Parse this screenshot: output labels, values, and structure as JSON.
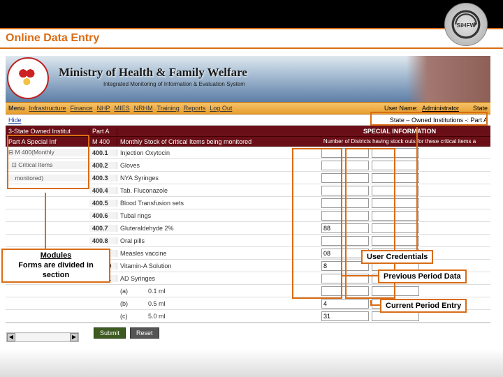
{
  "slide": {
    "title": "Online Data Entry"
  },
  "logo": {
    "name": "sihfw-logo"
  },
  "banner": {
    "ministry": "Ministry of Health & Family Welfare",
    "subtitle": "Integrated Monitoring of Information & Evaluation System",
    "badge_alt": "NRHM"
  },
  "menubar": {
    "menu_label": "Menu",
    "items": [
      "Infrastructure",
      "Finance",
      "NHP",
      "MIES",
      "NRHM",
      "Training",
      "Reports",
      "Log Out"
    ],
    "user_label": "User Name:",
    "user_value": "Administrator",
    "state_label": "State"
  },
  "substrip": {
    "hide": "Hide",
    "right": "State – Owned Institutions -: Part A"
  },
  "special_row": {
    "left": "3-State Owned Institut",
    "code": "Part A",
    "desc": "",
    "info_label": "SPECIAL INFORMATION",
    "info_sub": "Number of Districts having stock outs for these critical items a"
  },
  "header_row": {
    "left": "Part A Special Inf",
    "code": "M 400",
    "desc": "Monthly Stock of Critical Items being monitored"
  },
  "tree": {
    "root": "M 400(Monthly",
    "child": "Critical Items",
    "child2": "monitored)"
  },
  "rows": [
    {
      "code": "400.1",
      "desc": "Injection Oxytocin",
      "prev": "",
      "curr": ""
    },
    {
      "code": "400.2",
      "desc": "Gloves",
      "prev": "",
      "curr": ""
    },
    {
      "code": "400.3",
      "desc": "NYA Syringes",
      "prev": "",
      "curr": ""
    },
    {
      "code": "400.4",
      "desc": "Tab. Fluconazole",
      "prev": "",
      "curr": ""
    },
    {
      "code": "400.5",
      "desc": "Blood Transfusion sets",
      "prev": "",
      "curr": ""
    },
    {
      "code": "400.6",
      "desc": "Tubal rings",
      "prev": "",
      "curr": ""
    },
    {
      "code": "400.7",
      "desc": "Gluteraldehyde 2%",
      "prev": "88",
      "curr": ""
    },
    {
      "code": "400.8",
      "desc": "Oral pills",
      "prev": "",
      "curr": ""
    },
    {
      "code": "400.9",
      "desc": "Measles vaccine",
      "prev": "08",
      "curr": ""
    },
    {
      "code": "400.10",
      "desc": "Vitamin-A Solution",
      "prev": "8",
      "curr": ""
    },
    {
      "code": "400.11",
      "desc": "AD Syringes",
      "prev": "",
      "curr": ""
    }
  ],
  "subrows": [
    {
      "code": "(a)",
      "desc": "0.1 ml",
      "prev": "",
      "curr": ""
    },
    {
      "code": "(b)",
      "desc": "0.5 ml",
      "prev": "4",
      "curr": ""
    },
    {
      "code": "(c)",
      "desc": "5.0 ml",
      "prev": "31",
      "curr": ""
    }
  ],
  "buttons": {
    "submit": "Submit",
    "reset": "Reset"
  },
  "callouts": {
    "modules": "Modules",
    "modules2": "Forms are divided in section",
    "user_cred": "User Credentials",
    "prev_period": "Previous Period Data",
    "curr_period": "Current Period Entry"
  }
}
